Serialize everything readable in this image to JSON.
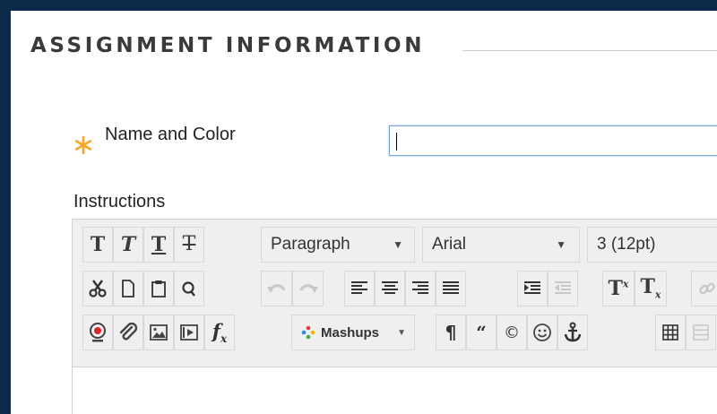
{
  "section": {
    "title": "ASSIGNMENT INFORMATION"
  },
  "form": {
    "name_label": "Name and Color",
    "name_value": "",
    "instructions_label": "Instructions"
  },
  "editor": {
    "paragraph_format": "Paragraph",
    "font_family": "Arial",
    "font_size": "3 (12pt)",
    "mashups_label": "Mashups",
    "dropdown_arrow": "▼"
  },
  "colors": {
    "required_star": "#f5a623",
    "frame_border": "#0c2a4a",
    "input_focus": "#7aa6d6",
    "toolbar_bg": "#efefef"
  },
  "icons": [
    "required-star-icon",
    "bold-icon",
    "italic-icon",
    "underline-icon",
    "strikethrough-icon",
    "cut-icon",
    "copy-icon",
    "paste-icon",
    "find-icon",
    "undo-icon",
    "redo-icon",
    "align-left-icon",
    "align-center-icon",
    "align-right-icon",
    "align-justify-icon",
    "indent-icon",
    "outdent-icon",
    "superscript-icon",
    "subscript-icon",
    "link-icon",
    "record-icon",
    "attach-icon",
    "image-icon",
    "media-icon",
    "math-icon",
    "mashups-icon",
    "paragraph-mark-icon",
    "blockquote-icon",
    "copyright-icon",
    "emoticon-icon",
    "anchor-icon",
    "table-icon"
  ]
}
